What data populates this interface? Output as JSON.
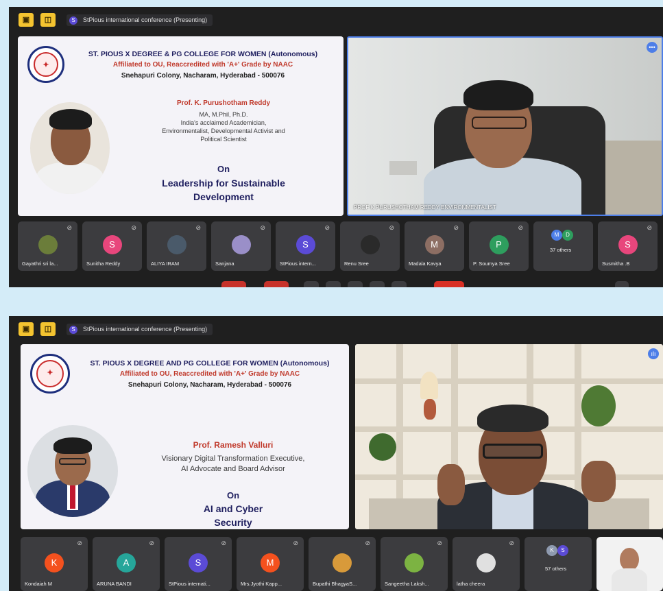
{
  "screens": [
    {
      "meeting_chip": {
        "badge": "S",
        "label": "StPious international conference (Presenting)"
      },
      "toolbar": {
        "btn1": "▣",
        "btn2": "◫"
      },
      "slide": {
        "college_name": "ST. PIOUS X DEGREE & PG COLLEGE FOR WOMEN (Autonomous)",
        "affiliation": "Affiliated to OU, Reaccredited with 'A+' Grade by NAAC",
        "address": "Snehapuri Colony, Nacharam, Hyderabad - 500076",
        "speaker_name": "Prof. K. Purushotham Reddy",
        "speaker_desc_1": "MA, M.Phil, Ph.D.",
        "speaker_desc_2": "India's acclaimed Academician,",
        "speaker_desc_3": "Environmentalist, Developmental Activist and",
        "speaker_desc_4": "Political Scientist",
        "on": "On",
        "topic_1": "Leadership for Sustainable",
        "topic_2": "Development"
      },
      "video": {
        "name_tag": "PROF K PURUSHOTHAM REDDY ENVIRONMENTALIST",
        "indicator": "•••"
      },
      "participants": [
        {
          "name": "Gayathri sri la...",
          "initial": "",
          "color": "#6b7d3a"
        },
        {
          "name": "Sunitha Reddy",
          "initial": "S",
          "color": "#e8467c"
        },
        {
          "name": "ALIYA IRAM",
          "initial": "",
          "color": "#4a5a6a"
        },
        {
          "name": "Sanjana",
          "initial": "",
          "color": "#9a8fc8"
        },
        {
          "name": "StPious intern...",
          "initial": "S",
          "color": "#5b4bd6"
        },
        {
          "name": "Renu Sree",
          "initial": "",
          "color": "#2a2a2a"
        },
        {
          "name": "Madala Kavya",
          "initial": "M",
          "color": "#8d6e63"
        },
        {
          "name": "P. Soumya Sree",
          "initial": "P",
          "color": "#2e9e5e"
        },
        {
          "name": "37 others",
          "initial": "",
          "color": ""
        },
        {
          "name": "Susmitha .B",
          "initial": "S",
          "color": "#e8467c"
        }
      ],
      "others_badges": [
        "M",
        "D"
      ]
    },
    {
      "meeting_chip": {
        "badge": "S",
        "label": "StPious international conference (Presenting)"
      },
      "toolbar": {
        "btn1": "▣",
        "btn2": "◫"
      },
      "slide": {
        "college_name": "ST. PIOUS X DEGREE AND PG COLLEGE FOR WOMEN (Autonomous)",
        "affiliation": "Affiliated to OU, Reaccredited with 'A+' Grade by NAAC",
        "address": "Snehapuri Colony, Nacharam, Hyderabad - 500076",
        "speaker_name": "Prof. Ramesh Valluri",
        "speaker_desc_1": "Visionary Digital Transformation Executive,",
        "speaker_desc_2": "AI Advocate and Board Advisor",
        "on": "On",
        "topic_1": "AI and Cyber",
        "topic_2": "Security"
      },
      "video": {
        "name_tag": "",
        "indicator": "ılı"
      },
      "participants": [
        {
          "name": "Kondaiah M",
          "initial": "K",
          "color": "#f4511e"
        },
        {
          "name": "ARUNA BANDI",
          "initial": "A",
          "color": "#26a69a"
        },
        {
          "name": "StPious internati...",
          "initial": "S",
          "color": "#5b4bd6"
        },
        {
          "name": "Mrs.Jyothi Kapp...",
          "initial": "M",
          "color": "#f4511e"
        },
        {
          "name": "Bupathi BhagyaS...",
          "initial": "",
          "color": "#d89a3a"
        },
        {
          "name": "Sangeetha Laksh...",
          "initial": "",
          "color": "#7cb342"
        },
        {
          "name": "latha cheera",
          "initial": "",
          "color": "#e0e0e0"
        },
        {
          "name": "57 others",
          "initial": "",
          "color": ""
        },
        {
          "name": "",
          "initial": "",
          "color": ""
        }
      ],
      "others_badges": [
        "K",
        "S"
      ],
      "logo_text": [
        "TRUTH",
        "LIGHT",
        "LIFE"
      ]
    }
  ]
}
